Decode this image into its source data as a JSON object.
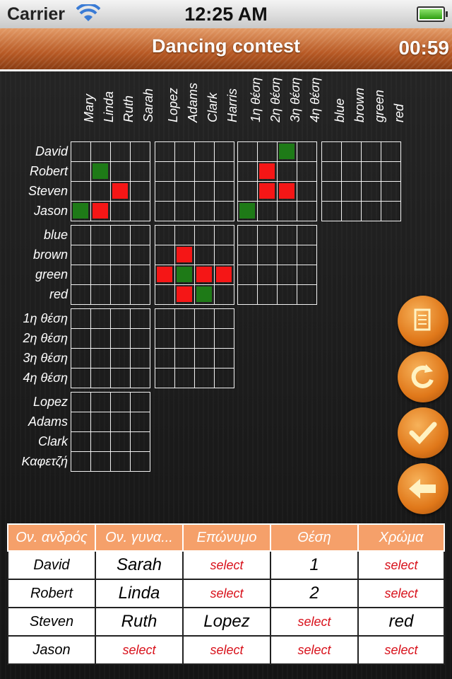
{
  "status": {
    "carrier": "Carrier",
    "time": "12:25 AM"
  },
  "header": {
    "title": "Dancing contest",
    "timer": "00:59"
  },
  "columns": [
    "Mary",
    "Linda",
    "Ruth",
    "Sarah",
    "Lopez",
    "Adams",
    "Clark",
    "Harris",
    "1η θέση",
    "2η θέση",
    "3η θέση",
    "4η θέση",
    "blue",
    "brown",
    "green",
    "red"
  ],
  "rows": [
    "David",
    "Robert",
    "Steven",
    "Jason",
    "blue",
    "brown",
    "green",
    "red",
    "1η θέση",
    "2η θέση",
    "3η θέση",
    "4η θέση",
    "Lopez",
    "Adams",
    "Clark",
    "Καφετζή"
  ],
  "grid_marks": [
    {
      "block": "men-women",
      "r": 1,
      "c": 1,
      "state": "green"
    },
    {
      "block": "men-women",
      "r": 2,
      "c": 2,
      "state": "red"
    },
    {
      "block": "men-women",
      "r": 3,
      "c": 0,
      "state": "green"
    },
    {
      "block": "men-women",
      "r": 3,
      "c": 1,
      "state": "red"
    },
    {
      "block": "men-positions",
      "r": 0,
      "c": 2,
      "state": "green"
    },
    {
      "block": "men-positions",
      "r": 1,
      "c": 1,
      "state": "red"
    },
    {
      "block": "men-positions",
      "r": 2,
      "c": 1,
      "state": "red"
    },
    {
      "block": "men-positions",
      "r": 2,
      "c": 2,
      "state": "red"
    },
    {
      "block": "men-positions",
      "r": 3,
      "c": 0,
      "state": "green"
    },
    {
      "block": "colors-surnames",
      "r": 1,
      "c": 1,
      "state": "red"
    },
    {
      "block": "colors-surnames",
      "r": 2,
      "c": 0,
      "state": "red"
    },
    {
      "block": "colors-surnames",
      "r": 2,
      "c": 1,
      "state": "green"
    },
    {
      "block": "colors-surnames",
      "r": 2,
      "c": 2,
      "state": "red"
    },
    {
      "block": "colors-surnames",
      "r": 2,
      "c": 3,
      "state": "red"
    },
    {
      "block": "colors-surnames",
      "r": 3,
      "c": 1,
      "state": "red"
    },
    {
      "block": "colors-surnames",
      "r": 3,
      "c": 2,
      "state": "green"
    }
  ],
  "side_buttons": [
    "notes-icon",
    "restart-icon",
    "check-icon",
    "back-arrow-icon"
  ],
  "table": {
    "headers": [
      "Ον. ανδρός",
      "Ον. γυνα...",
      "Επώνυμο",
      "Θέση",
      "Χρώμα"
    ],
    "rows": [
      [
        "David",
        "Sarah",
        "select",
        "1",
        "select"
      ],
      [
        "Robert",
        "Linda",
        "select",
        "2",
        "select"
      ],
      [
        "Steven",
        "Ruth",
        "Lopez",
        "select",
        "red"
      ],
      [
        "Jason",
        "select",
        "select",
        "select",
        "select"
      ]
    ]
  },
  "colors": {
    "accent": "#f5a06a",
    "mark_red": "#f51616",
    "mark_green": "#1e7a17",
    "select_text": "#d8101a"
  }
}
